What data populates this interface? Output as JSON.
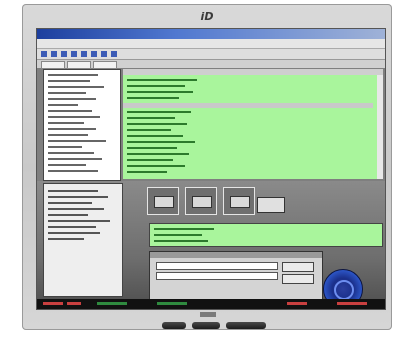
{
  "monitor": {
    "logo_text": "iD",
    "icons": {
      "logo": "brand-logo-icon",
      "power": "power-button-icon",
      "monitor": "monitor-icon"
    }
  },
  "screen": {
    "icons": {
      "tree": "folder-tree-icon",
      "disc": "disc-icon"
    },
    "colors": {
      "titlebar_from": "#1d3f9e",
      "titlebar_to": "#9fb2d7",
      "list_highlight": "#a9f59c",
      "disc_blue": "#2b3f9e",
      "status_red": "#c94040",
      "status_green": "#2f8a3f"
    }
  }
}
